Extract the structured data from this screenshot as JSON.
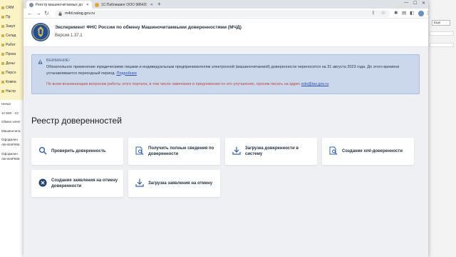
{
  "background_app": {
    "sidebar_items": [
      "CRM",
      "Пр",
      "Закуп",
      "Склад",
      "Работ",
      "Произ",
      "Деньг",
      "Персо",
      "Компа",
      "Настр"
    ],
    "start_item": "Начал",
    "panel_items": [
      "1C:EDI · 1C",
      "Обмен элект",
      "Машиночита",
      "Оформлен",
      "AB-004P906",
      "Оформлен",
      "AB-004P906"
    ],
    "right_select": "Еще"
  },
  "browser": {
    "tabs": [
      {
        "label": "Реестр машиночитаемых дове...",
        "active": true
      },
      {
        "label": "1С:Паблишинг ООО 986429867...",
        "active": false
      }
    ],
    "url": "m4d.nalog.gov.ru"
  },
  "site": {
    "title": "Эксперимент ФНС России по обмену Машиночитаемыми доверенностями (МЧД)",
    "version": "Версия 1.37.1"
  },
  "alert": {
    "title": "ВНИМАНИЕ!",
    "text": "Обязательное применение юридическими лицами и индивидуальным предпринимателям электронной (машиночитаемой) доверенности переносится на 31 августа 2023 года. До этого времени устанавливается переходный период.",
    "link": "Подробнее",
    "contact_text": "По всем возникающим вопросам работы этого портала, в том числе замечания и предложения по его улучшению, просим писать на адрес",
    "contact_email": "edo@tax.gov.ru"
  },
  "page_title": "Реестр доверенностей",
  "cards": [
    {
      "label": "Проверить доверенность",
      "icon": "search-icon"
    },
    {
      "label": "Получить полные сведения по доверенности",
      "icon": "document-search-icon"
    },
    {
      "label": "Загрузка доверенности в систему",
      "icon": "download-icon"
    },
    {
      "label": "Создание xml-доверенности",
      "icon": "document-search-icon"
    },
    {
      "label": "Создание заявления на отмену доверенности",
      "icon": "cancel-icon"
    },
    {
      "label": "Загрузка заявления на отмену",
      "icon": "download-icon"
    }
  ],
  "colors": {
    "alert_bg": "#cbd8ec",
    "alert_border": "#a9bde0",
    "contact_red": "#c0463b",
    "link_blue": "#2c4fb0",
    "icon_blue": "#2f5fa8",
    "cancel_icon_bg": "#1f3f74"
  }
}
